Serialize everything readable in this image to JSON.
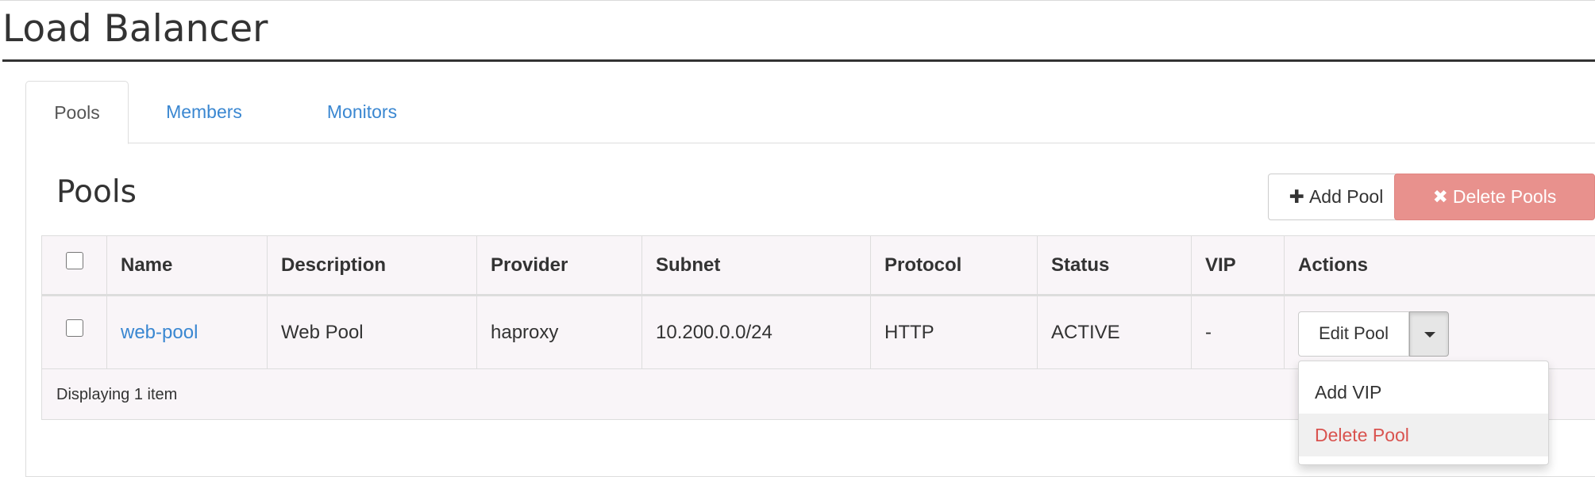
{
  "header": {
    "title": "Load Balancer"
  },
  "tabs": [
    {
      "label": "Pools",
      "active": true
    },
    {
      "label": "Members",
      "active": false
    },
    {
      "label": "Monitors",
      "active": false
    }
  ],
  "section": {
    "title": "Pools",
    "add_button": {
      "icon": "plus-icon",
      "label": "Add Pool"
    },
    "delete_button": {
      "icon": "x-icon",
      "label": "Delete Pools"
    }
  },
  "table": {
    "columns": [
      "Name",
      "Description",
      "Provider",
      "Subnet",
      "Protocol",
      "Status",
      "VIP",
      "Actions"
    ],
    "rows": [
      {
        "name": "web-pool",
        "description": "Web Pool",
        "provider": "haproxy",
        "subnet": "10.200.0.0/24",
        "protocol": "HTTP",
        "status": "ACTIVE",
        "vip": "-",
        "action_label": "Edit Pool"
      }
    ],
    "footer": "Displaying 1 item"
  },
  "dropdown": {
    "items": [
      "Add VIP",
      "Delete Pool"
    ]
  },
  "colors": {
    "link": "#3a87d1",
    "danger_button": "#e8918d",
    "danger_text": "#d9534f"
  }
}
